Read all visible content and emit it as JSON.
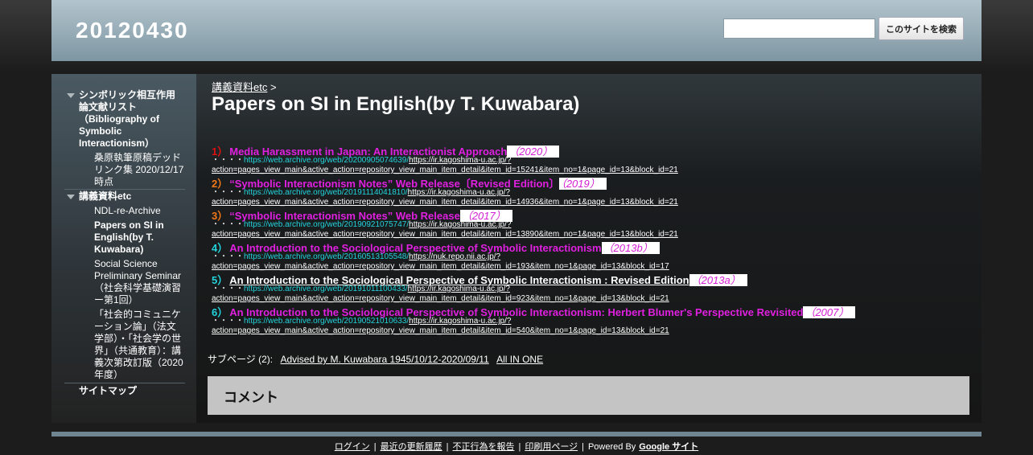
{
  "header": {
    "site_title": "20120430",
    "search_placeholder": "",
    "search_button": "このサイトを検索"
  },
  "sidebar": {
    "items": [
      {
        "label": "シンボリック相互作用論文献リスト（Bibliography of Symbolic Interactionism）"
      },
      {
        "label": "桑原執筆原稿デッドリンク集 2020/12/17時点"
      },
      {
        "label": "講義資料etc"
      },
      {
        "label": "NDL-re-Archive"
      },
      {
        "label": "Papers on SI in English(by T. Kuwabara)"
      },
      {
        "label": "Social Science Preliminary Seminar（社会科学基礎演習ー第1回）"
      },
      {
        "label": "「社会的コミュニケーション論」（法文学部）・「社会学の世界」（共通教育）：講義次第改訂版（2020年度）"
      },
      {
        "label": "サイトマップ"
      }
    ]
  },
  "main": {
    "breadcrumb_link": "講義資料etc",
    "breadcrumb_sep": ">",
    "title": "Papers on SI in English(by T. Kuwabara)",
    "entries": [
      {
        "num": "1）",
        "num_color": "#e01010",
        "title": "Media Harassment in Japan: An Interactionist Approach",
        "title_color": "#e020e0",
        "year": "（2020）",
        "dots": "・・・・",
        "archive": "https://web.archive.org/web/20200905074639/",
        "link1": "https://ir.kagoshima-u.ac.jp/?",
        "link2": "action=pages_view_main&active_action=repository_view_main_item_detail&item_id=15241&item_no=1&page_id=13&block_id=21"
      },
      {
        "num": "2）",
        "num_color": "#f07818",
        "title": "“Symbolic Interactionism Notes” Web Release〔Revised Edition〕",
        "title_color": "#e020e0",
        "year": "（2019）",
        "dots": "・・・・",
        "archive": "https://web.archive.org/web/20191114041810/",
        "link1": "https://ir.kagoshima-u.ac.jp/?",
        "link2": "action=pages_view_main&active_action=repository_view_main_item_detail&item_id=14936&item_no=1&page_id=13&block_id=21"
      },
      {
        "num": "3）",
        "num_color": "#f07818",
        "title": "“Symbolic Interactionism Notes” Web Release",
        "title_color": "#e020e0",
        "year": "（2017）",
        "dots": "・・・・",
        "archive": "https://web.archive.org/web/20190921075747/",
        "link1": "https://ir.kagoshima-u.ac.jp/?",
        "link2": "action=pages_view_main&active_action=repository_view_main_item_detail&item_id=13890&item_no=1&page_id=13&block_id=21"
      },
      {
        "num": "4）",
        "num_color": "#22d4dc",
        "title": "An Introduction to the Sociological Perspective of Symbolic Interactionism",
        "title_color": "#e020e0",
        "year": "（2013b）",
        "dots": "・・・・",
        "archive": "https://web.archive.org/web/20160513105548/",
        "link1": "https://nuk.repo.nii.ac.jp/?",
        "link2": "action=pages_view_main&active_action=repository_view_main_item_detail&item_id=193&item_no=1&page_id=13&block_id=17"
      },
      {
        "num": "5）",
        "num_color": "#22d4dc",
        "title": "An Introduction to the Sociological Perspective of Symbolic Interactionism : Revised Edition",
        "title_color": "#ffffff",
        "year": "（2013a）",
        "dots": "・・・・",
        "archive": "https://web.archive.org/web/20191011100433/",
        "link1": "https://ir.kagoshima-u.ac.jp/?",
        "link2": "action=pages_view_main&active_action=repository_view_main_item_detail&item_id=923&item_no=1&page_id=13&block_id=21"
      },
      {
        "num": "6）",
        "num_color": "#22d4dc",
        "title": "An Introduction to the Sociological Perspective of Symbolic Interactionism: Herbert Blumer's Perspective Revisited",
        "title_color": "#e020e0",
        "year": "（2007）",
        "dots": "・・・・",
        "archive": "https://web.archive.org/web/20190521010633/",
        "link1": "https://ir.kagoshima-u.ac.jp/?",
        "link2": "action=pages_view_main&active_action=repository_view_main_item_detail&item_id=540&item_no=1&page_id=13&block_id=21"
      }
    ],
    "subpages_label": "サブページ (2):",
    "subpages": [
      "Advised by M. Kuwabara 1945/10/12-2020/09/11",
      "All IN ONE"
    ],
    "comment_title": "コメント"
  },
  "footer": {
    "login": "ログイン",
    "recent": "最近の更新履歴",
    "report": "不正行為を報告",
    "print": "印刷用ページ",
    "sep": "|",
    "powered": "Powered By",
    "google_sites": "Google サイト"
  }
}
